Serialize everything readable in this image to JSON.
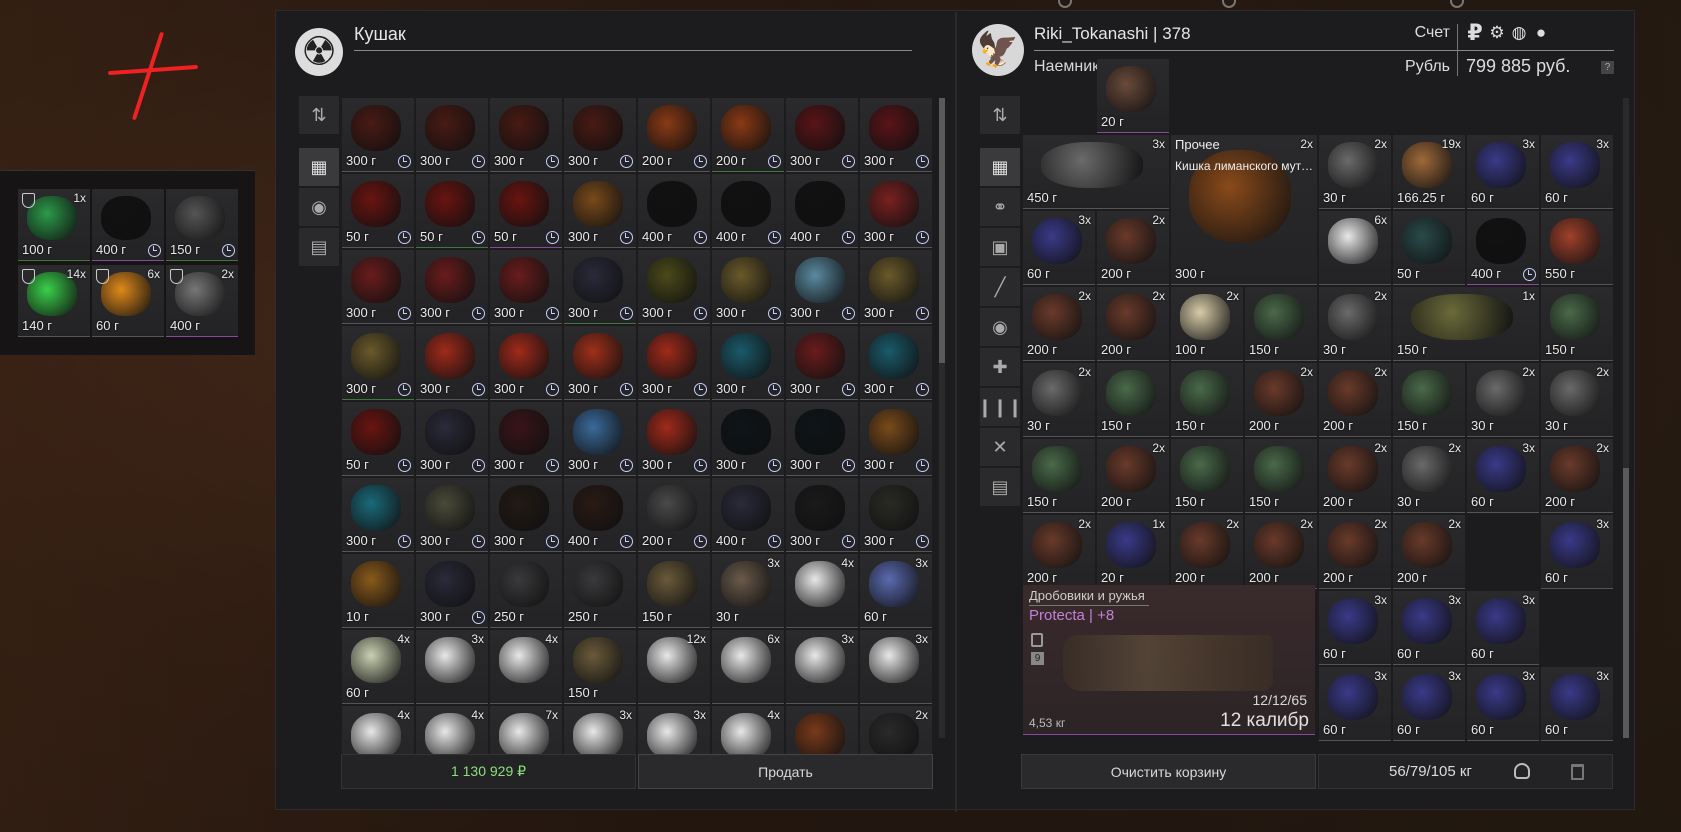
{
  "trader": {
    "name": "Кушак",
    "total": "1 130 929 ₽",
    "sell_label": "Продать"
  },
  "player": {
    "name": "Riki_Tokanashi | 378",
    "faction": "Наемники",
    "account_label": "Счет",
    "currency_label": "Рубль",
    "money": "799 885 руб.",
    "help": "?",
    "clear_label": "Очистить корзину",
    "weight": "56/79/105 кг"
  },
  "side_items": [
    {
      "w": "100 г",
      "q": "1x",
      "c": "#2c9a4a",
      "shield": true,
      "g": true
    },
    {
      "w": "400 г",
      "q": "",
      "c": "#111",
      "clock": true,
      "p": true
    },
    {
      "w": "150 г",
      "q": "",
      "c": "#555",
      "clock": true,
      "g": true
    },
    {
      "w": "140 г",
      "q": "14x",
      "c": "#3ad04a",
      "shield": true
    },
    {
      "w": "60 г",
      "q": "6x",
      "c": "#e08a1a",
      "shield": true
    },
    {
      "w": "400 г",
      "q": "2x",
      "c": "#777",
      "shield": true,
      "p": true
    }
  ],
  "trader_items": [
    {
      "w": "300 г",
      "c": "#4a1a14",
      "clock": true
    },
    {
      "w": "300 г",
      "c": "#4a1a14",
      "clock": true
    },
    {
      "w": "300 г",
      "c": "#4a1a14",
      "clock": true
    },
    {
      "w": "300 г",
      "c": "#4a1a14",
      "clock": true
    },
    {
      "w": "200 г",
      "c": "#8a3a14",
      "clock": true
    },
    {
      "w": "200 г",
      "c": "#8a3a14",
      "clock": true,
      "g": true
    },
    {
      "w": "300 г",
      "c": "#5a1418",
      "clock": true
    },
    {
      "w": "300 г",
      "c": "#5a1418",
      "clock": true
    },
    {
      "w": "50 г",
      "c": "#6a1410",
      "clock": true
    },
    {
      "w": "50 г",
      "c": "#6a1410",
      "clock": true,
      "g": true
    },
    {
      "w": "50 г",
      "c": "#6a1410",
      "clock": true,
      "p": true
    },
    {
      "w": "300 г",
      "c": "#7a4a1a",
      "clock": true
    },
    {
      "w": "400 г",
      "c": "#111",
      "clock": true
    },
    {
      "w": "400 г",
      "c": "#111",
      "clock": true
    },
    {
      "w": "400 г",
      "c": "#111",
      "clock": true
    },
    {
      "w": "300 г",
      "c": "#7a2020",
      "clock": true
    },
    {
      "w": "300 г",
      "c": "#6a1c1c",
      "clock": true
    },
    {
      "w": "300 г",
      "c": "#6a1c1c",
      "clock": true
    },
    {
      "w": "300 г",
      "c": "#6a1c1c",
      "clock": true
    },
    {
      "w": "300 г",
      "c": "#2a2a3a",
      "clock": true,
      "g": true
    },
    {
      "w": "300 г",
      "c": "#4a4a1a",
      "clock": true
    },
    {
      "w": "300 г",
      "c": "#6a5a2a",
      "clock": true
    },
    {
      "w": "300 г",
      "c": "#5a8aa0",
      "clock": true
    },
    {
      "w": "300 г",
      "c": "#6a5a2a",
      "clock": true
    },
    {
      "w": "300 г",
      "c": "#6a5a2a",
      "clock": true,
      "g": true
    },
    {
      "w": "300 г",
      "c": "#a02a1a",
      "clock": true
    },
    {
      "w": "300 г",
      "c": "#a02a1a",
      "clock": true
    },
    {
      "w": "300 г",
      "c": "#a0301a",
      "clock": true
    },
    {
      "w": "300 г",
      "c": "#a02a1a",
      "clock": true
    },
    {
      "w": "300 г",
      "c": "#1a5a6a",
      "clock": true
    },
    {
      "w": "300 г",
      "c": "#6a1c1c",
      "clock": true
    },
    {
      "w": "300 г",
      "c": "#1a5a6a",
      "clock": true
    },
    {
      "w": "50 г",
      "c": "#6a1410",
      "clock": true
    },
    {
      "w": "300 г",
      "c": "#2a2a3a",
      "clock": true
    },
    {
      "w": "300 г",
      "c": "#3a1418",
      "clock": true
    },
    {
      "w": "300 г",
      "c": "#3a6a9a",
      "clock": true
    },
    {
      "w": "300 г",
      "c": "#a02a1a",
      "clock": true
    },
    {
      "w": "300 г",
      "c": "#0e1418",
      "clock": true
    },
    {
      "w": "300 г",
      "c": "#0e1418",
      "clock": true
    },
    {
      "w": "300 г",
      "c": "#7a4a1a",
      "clock": true
    },
    {
      "w": "300 г",
      "c": "#1a6a7a",
      "clock": true
    },
    {
      "w": "300 г",
      "c": "#4a4a3a",
      "clock": true
    },
    {
      "w": "300 г",
      "c": "#221a14",
      "clock": true
    },
    {
      "w": "400 г",
      "c": "#2a1a14",
      "clock": true
    },
    {
      "w": "200 г",
      "c": "#4a4a4a",
      "clock": true
    },
    {
      "w": "400 г",
      "c": "#2a2a3a",
      "clock": true
    },
    {
      "w": "300 г",
      "c": "#1a1a1a",
      "clock": true
    },
    {
      "w": "300 г",
      "c": "#2a2a24",
      "clock": true
    },
    {
      "w": "10 г",
      "c": "#8a5a1a"
    },
    {
      "w": "300 г",
      "c": "#2a2a3a",
      "clock": true
    },
    {
      "w": "250 г",
      "c": "#3a3a3c"
    },
    {
      "w": "250 г",
      "c": "#3a3a3c"
    },
    {
      "w": "150 г",
      "c": "#6a5a3a"
    },
    {
      "w": "30 г",
      "q": "3x",
      "c": "#6a5a4a"
    },
    {
      "w": "",
      "q": "4x",
      "c": "#e8e8e8"
    },
    {
      "w": "60 г",
      "q": "3x",
      "c": "#5a6ab0"
    },
    {
      "w": "60 г",
      "q": "4x",
      "c": "#c8d0b0"
    },
    {
      "w": "",
      "q": "3x",
      "c": "#e8e8e8"
    },
    {
      "w": "",
      "q": "4x",
      "c": "#e8e8e8"
    },
    {
      "w": "150 г",
      "c": "#6a5a3a"
    },
    {
      "w": "",
      "q": "12x",
      "c": "#e8e8e8"
    },
    {
      "w": "",
      "q": "6x",
      "c": "#e8e8e8"
    },
    {
      "w": "",
      "q": "3x",
      "c": "#e8e8e8"
    },
    {
      "w": "",
      "q": "3x",
      "c": "#e8e8e8"
    },
    {
      "w": "",
      "q": "4x",
      "c": "#e8e8e8"
    },
    {
      "w": "",
      "q": "4x",
      "c": "#e8e8e8"
    },
    {
      "w": "",
      "q": "7x",
      "c": "#e8e8e8"
    },
    {
      "w": "",
      "q": "3x",
      "c": "#e8e8e8"
    },
    {
      "w": "",
      "q": "3x",
      "c": "#e8e8e8"
    },
    {
      "w": "",
      "q": "4x",
      "c": "#e8e8e8"
    },
    {
      "w": "",
      "q": "",
      "c": "#7a3a1a"
    },
    {
      "w": "",
      "q": "2x",
      "c": "#2a2a2a"
    }
  ],
  "player_items": [
    {
      "w": "450 г",
      "q": "3x",
      "c": "#6a6a6a",
      "col": 1,
      "row": 2,
      "cs": 2
    },
    {
      "w": "300 г",
      "q": "2x",
      "c": "#8a4a1a",
      "col": 3,
      "row": 2,
      "cs": 2,
      "rs": 2,
      "lbl": "Прочее",
      "sub": "Кишка лиманского мута..."
    },
    {
      "w": "30 г",
      "q": "2x",
      "c": "#6a6a6a",
      "col": 5,
      "row": 2
    },
    {
      "w": "166.25 г",
      "q": "19x",
      "c": "#a06a3a",
      "col": 6,
      "row": 2
    },
    {
      "w": "60 г",
      "q": "3x",
      "c": "#3a3a8a",
      "col": 7,
      "row": 2
    },
    {
      "w": "60 г",
      "q": "3x",
      "c": "#3a3a8a",
      "col": 8,
      "row": 2
    },
    {
      "w": "60 г",
      "q": "3x",
      "c": "#3a3a8a",
      "col": 1,
      "row": 3
    },
    {
      "w": "200 г",
      "q": "2x",
      "c": "#6a3a2a",
      "col": 2,
      "row": 3
    },
    {
      "w": "",
      "q": "6x",
      "c": "#e8e8e8",
      "col": 5,
      "row": 3
    },
    {
      "w": "50 г",
      "q": "",
      "c": "#2a4a4a",
      "col": 6,
      "row": 3
    },
    {
      "w": "400 г",
      "q": "",
      "c": "#111",
      "col": 7,
      "row": 3,
      "clock": true,
      "p": true
    },
    {
      "w": "550 г",
      "q": "",
      "c": "#a0402a",
      "col": 8,
      "row": 3
    },
    {
      "w": "200 г",
      "q": "2x",
      "c": "#6a3a2a",
      "col": 1,
      "row": 4
    },
    {
      "w": "200 г",
      "q": "2x",
      "c": "#6a3a2a",
      "col": 2,
      "row": 4
    },
    {
      "w": "100 г",
      "q": "2x",
      "c": "#d8cca8",
      "col": 3,
      "row": 4
    },
    {
      "w": "150 г",
      "q": "",
      "c": "#4a6a4a",
      "col": 4,
      "row": 4
    },
    {
      "w": "30 г",
      "q": "2x",
      "c": "#6a6a6a",
      "col": 5,
      "row": 4
    },
    {
      "w": "150 г",
      "q": "1x",
      "c": "#6a6a3a",
      "col": 6,
      "row": 4,
      "cs": 2
    },
    {
      "w": "150 г",
      "q": "",
      "c": "#4a6a4a",
      "col": 8,
      "row": 4
    },
    {
      "w": "30 г",
      "q": "2x",
      "c": "#6a6a6a",
      "col": 1,
      "row": 5
    },
    {
      "w": "150 г",
      "q": "",
      "c": "#4a6a4a",
      "col": 2,
      "row": 5
    },
    {
      "w": "150 г",
      "q": "",
      "c": "#4a6a4a",
      "col": 3,
      "row": 5
    },
    {
      "w": "200 г",
      "q": "2x",
      "c": "#6a3a2a",
      "col": 4,
      "row": 5
    },
    {
      "w": "200 г",
      "q": "2x",
      "c": "#6a3a2a",
      "col": 5,
      "row": 5
    },
    {
      "w": "150 г",
      "q": "",
      "c": "#4a6a4a",
      "col": 6,
      "row": 5
    },
    {
      "w": "30 г",
      "q": "2x",
      "c": "#6a6a6a",
      "col": 7,
      "row": 5
    },
    {
      "w": "30 г",
      "q": "2x",
      "c": "#6a6a6a",
      "col": 8,
      "row": 5
    },
    {
      "w": "150 г",
      "q": "",
      "c": "#4a6a4a",
      "col": 1,
      "row": 6
    },
    {
      "w": "200 г",
      "q": "2x",
      "c": "#6a3a2a",
      "col": 2,
      "row": 6
    },
    {
      "w": "150 г",
      "q": "",
      "c": "#4a6a4a",
      "col": 3,
      "row": 6
    },
    {
      "w": "150 г",
      "q": "",
      "c": "#4a6a4a",
      "col": 4,
      "row": 6
    },
    {
      "w": "200 г",
      "q": "2x",
      "c": "#6a3a2a",
      "col": 5,
      "row": 6
    },
    {
      "w": "30 г",
      "q": "2x",
      "c": "#6a6a6a",
      "col": 6,
      "row": 6
    },
    {
      "w": "60 г",
      "q": "3x",
      "c": "#3a3a8a",
      "col": 7,
      "row": 6
    },
    {
      "w": "200 г",
      "q": "2x",
      "c": "#6a3a2a",
      "col": 8,
      "row": 6
    },
    {
      "w": "200 г",
      "q": "2x",
      "c": "#6a3a2a",
      "col": 1,
      "row": 7
    },
    {
      "w": "20 г",
      "q": "1x",
      "c": "#3a3a8a",
      "col": 2,
      "row": 7
    },
    {
      "w": "200 г",
      "q": "2x",
      "c": "#6a3a2a",
      "col": 3,
      "row": 7
    },
    {
      "w": "200 г",
      "q": "2x",
      "c": "#6a3a2a",
      "col": 4,
      "row": 7
    },
    {
      "w": "200 г",
      "q": "2x",
      "c": "#6a3a2a",
      "col": 5,
      "row": 7
    },
    {
      "w": "200 г",
      "q": "2x",
      "c": "#6a3a2a",
      "col": 6,
      "row": 7
    },
    {
      "w": "60 г",
      "q": "3x",
      "c": "#3a3a8a",
      "col": 8,
      "row": 7
    },
    {
      "w": "60 г",
      "q": "3x",
      "c": "#3a3a8a",
      "col": 5,
      "row": 8
    },
    {
      "w": "60 г",
      "q": "3x",
      "c": "#3a3a8a",
      "col": 6,
      "row": 8
    },
    {
      "w": "60 г",
      "q": "3x",
      "c": "#3a3a8a",
      "col": 7,
      "row": 8
    },
    {
      "w": "60 г",
      "q": "3x",
      "c": "#3a3a8a",
      "col": 5,
      "row": 9
    },
    {
      "w": "60 г",
      "q": "3x",
      "c": "#3a3a8a",
      "col": 6,
      "row": 9
    },
    {
      "w": "60 г",
      "q": "3x",
      "c": "#3a3a8a",
      "col": 7,
      "row": 9
    },
    {
      "w": "60 г",
      "q": "3x",
      "c": "#3a3a8a",
      "col": 8,
      "row": 9
    },
    {
      "w": "20 г",
      "q": "",
      "c": "#6a4a3a",
      "col": 2,
      "row": 1,
      "p": true
    }
  ],
  "big_item": {
    "category": "Дробовики и ружья",
    "name": "Protecta | +8",
    "level": "9",
    "durability": "12/12/65",
    "weight": "4,53 кг",
    "caliber": "12 калибр"
  }
}
